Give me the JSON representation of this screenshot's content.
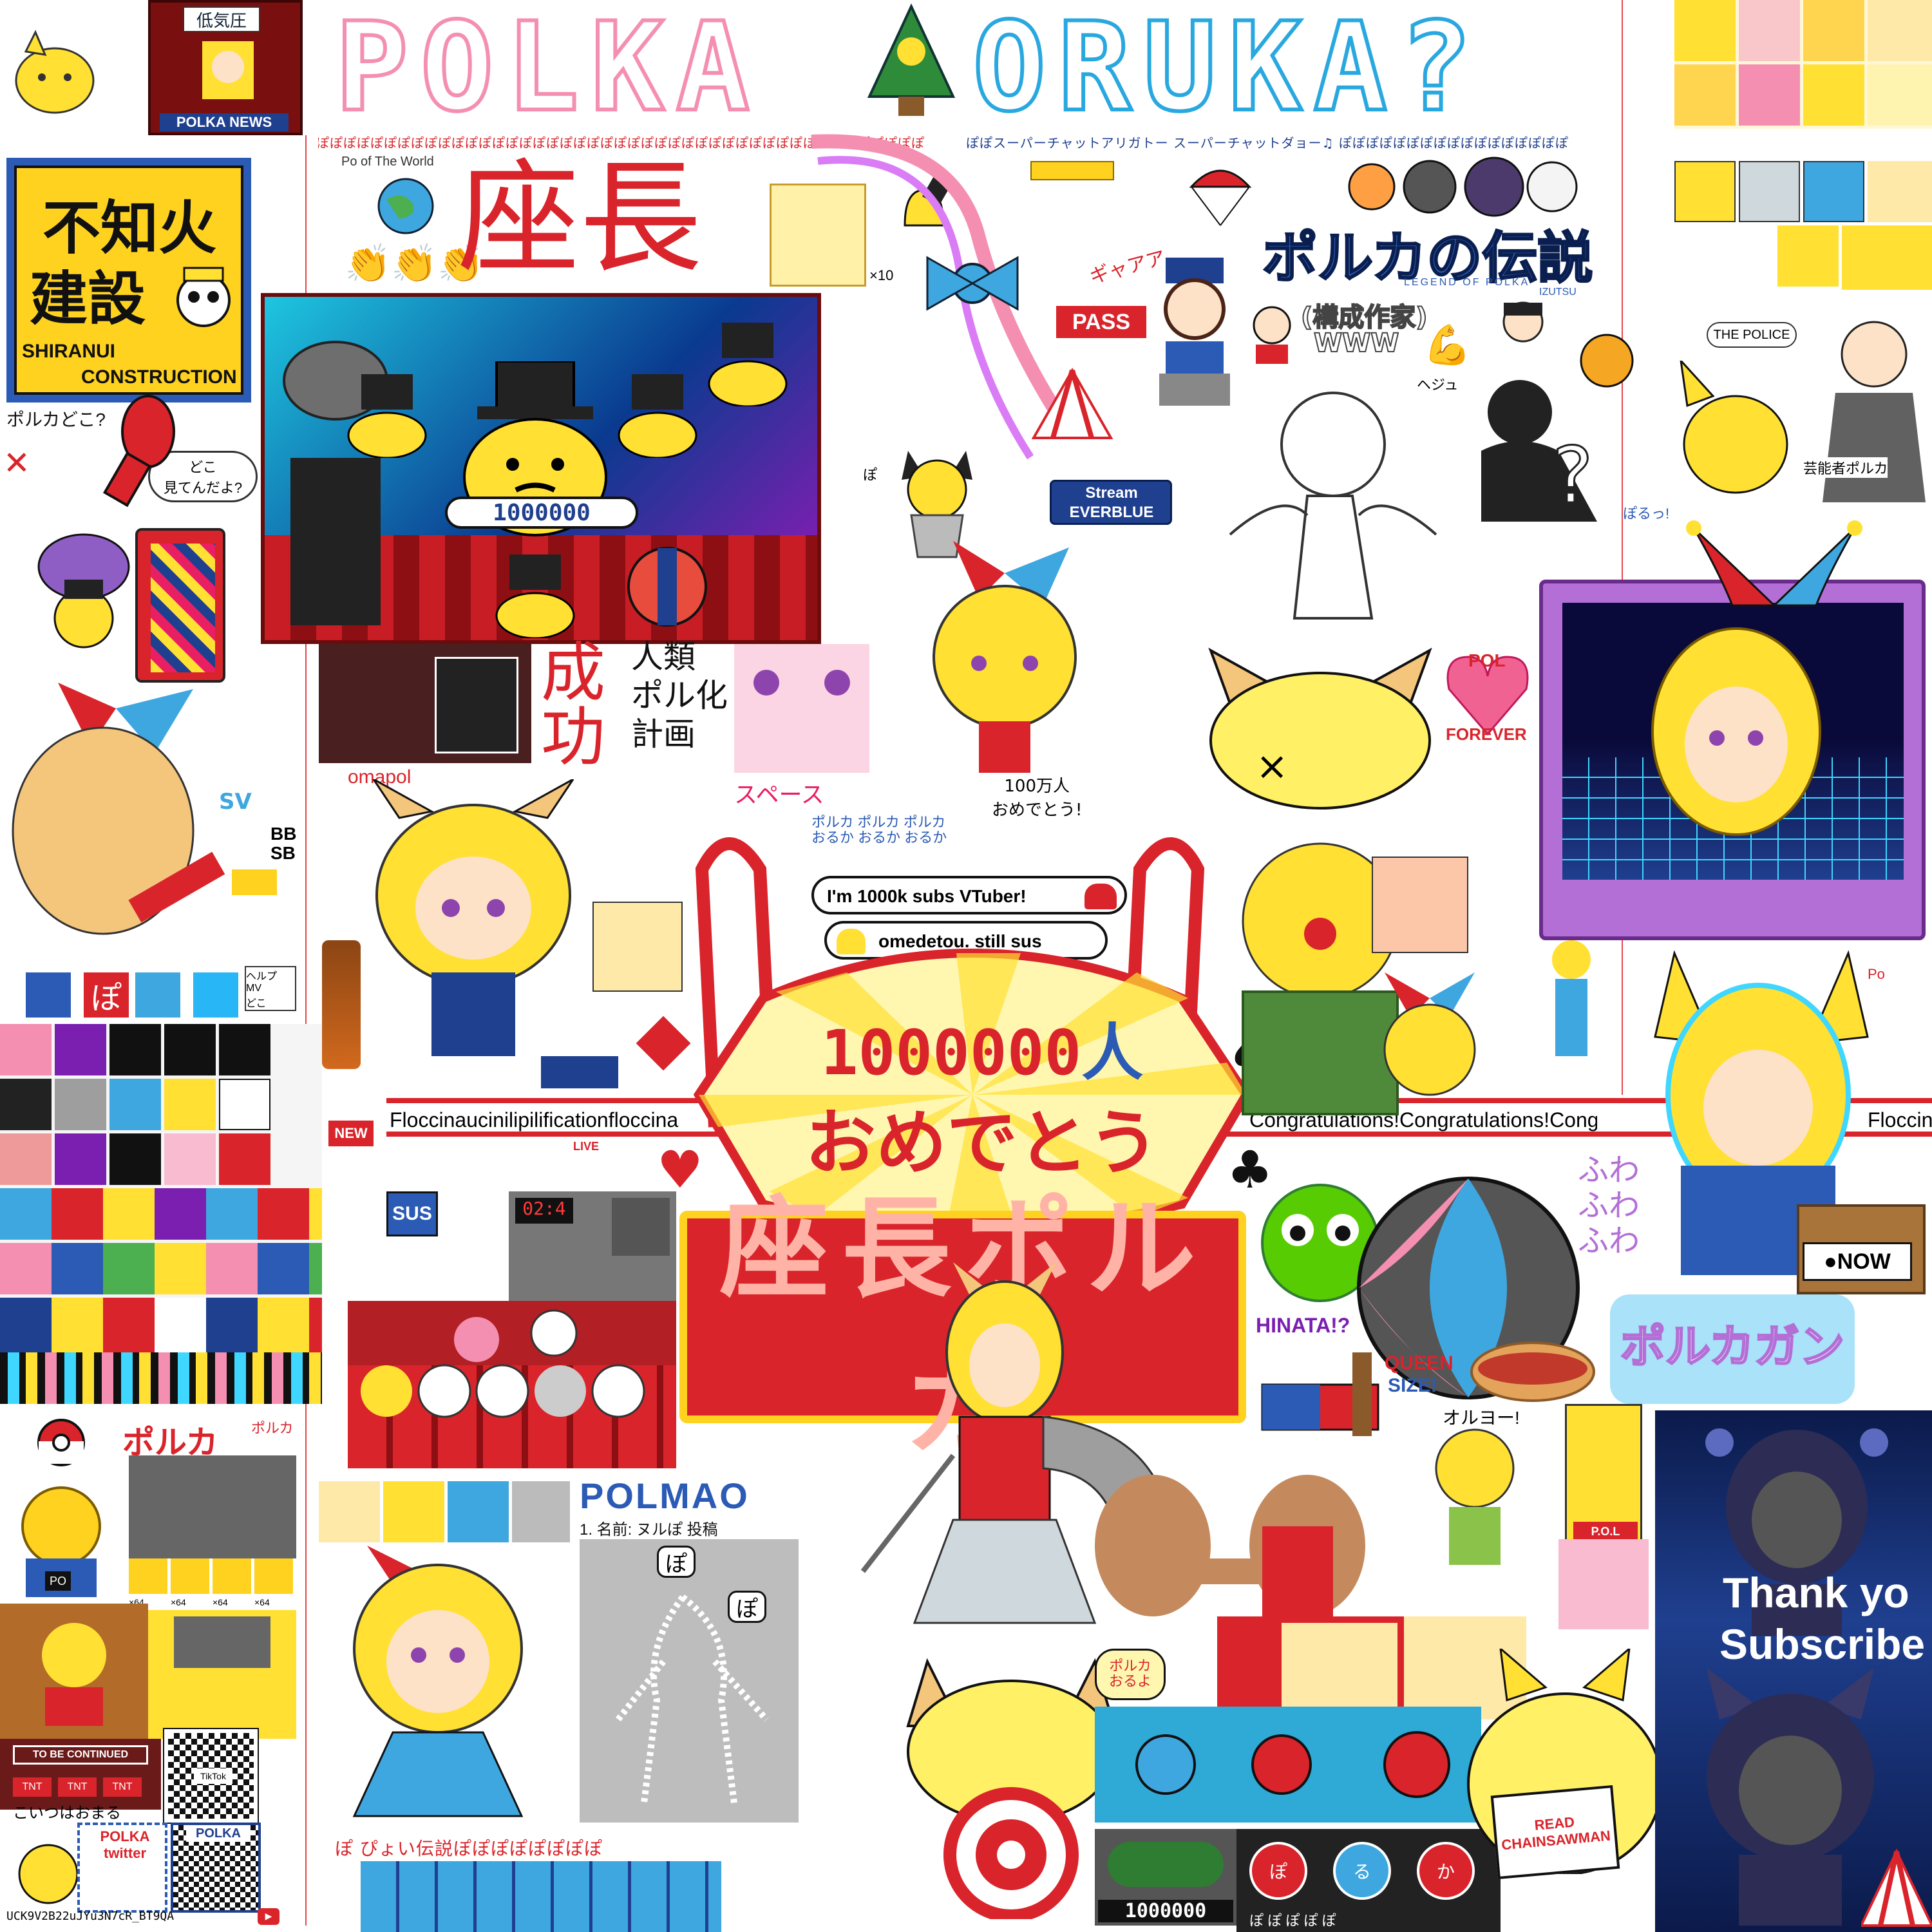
{
  "header": {
    "title_left": "POLKA",
    "title_right": "ORUKA?",
    "po_row": "ぽぽぽぽぽぽぽぽぽぽぽぽぽぽぽぽぽぽぽぽぽぽぽぽぽぽぽぽぽぽぽぽぽぽぽぽぽぽぽぽぽぽぽぽぽぽ",
    "superchat_text": "ぽぽスーパーチャットアリガトー スーパーチャットダョー♫ ぽぽぽぽぽぽぽぽぽぽぽぽぽぽぽぽぽ"
  },
  "top_left": {
    "news_sign": "低気圧",
    "news_banner": "POLKA NEWS",
    "construction_kanji_1": "不知火",
    "construction_kanji_2": "建設",
    "construction_en_1": "SHIRANUI",
    "construction_en_2": "CONSTRUCTION",
    "where_polka": "ポルカどこ?",
    "where_look": "どこ\n見てんだよ?"
  },
  "center_top": {
    "world_label": "Po of The World",
    "zacho": "座長",
    "x10": "×10",
    "gyaa": "ギャアア",
    "pass": "PASS",
    "stream_1": "Stream",
    "stream_2": "EVERBLUE",
    "po_small": "ぽ"
  },
  "right_top": {
    "legend_title": "ポルカの伝説",
    "legend_sub": "LEGEND OF POLKA",
    "izutsu": "IZUTSU",
    "kousei": "(構成作家)",
    "www": "WWW",
    "hegyu": "ヘジュ",
    "the_police": "THE POLICE",
    "geinou": "芸能者ポルカ",
    "porutsu": "ぽるっ!"
  },
  "middle": {
    "seikou": "成功",
    "jinrui_1": "人類",
    "jinrui_2": "ポル化",
    "jinrui_3": "計画",
    "omapol": "omapol",
    "space": "スペース",
    "million": "100万人\nおめでとう!",
    "polka_oruka": "ポルカ ポルカ ポルカ\nおるか おるか おるか",
    "sus_1": "I'm 1000k subs VTuber!",
    "sus_2": "omedetou. still sus",
    "pol_forever_1": "POL",
    "pol_forever_2": "FOREVER",
    "bbsb": "BB\nSB",
    "sv": "SV",
    "heru": "ヘルプ\nMV\nどこ",
    "new": "NEW",
    "live": "LIVE",
    "sus": "SUS",
    "time": "02:4"
  },
  "center_sign": {
    "subs_count": "1000000",
    "subs_unit": "人",
    "congrats": "おめでとう",
    "marquee_text": "座長ポルカ",
    "banner_left": "Floccinaucinilipilificationfloccina",
    "banner_right": "Congratulations!Congratulations!Congratulations!Congra",
    "banner_far": "Floccina"
  },
  "right_mid": {
    "fuwa": "ふわ\nふわ\nふわ",
    "now": "●NOW",
    "polkagun": "ポルカガン",
    "hinata": "HINATA!?",
    "queen_1": "QUEEN",
    "queen_2": "SIZE!",
    "oruyo_call": "オルヨー!",
    "po_side": "Po"
  },
  "bottom_left": {
    "polka_pink": "ポルカ",
    "poruka": "ポルカ",
    "x64": "×64",
    "to_be_continued": "TO BE CONTINUED",
    "tnt": "TNT",
    "koitsu": "こいつはおまる",
    "polka_twitter": "POLKA\ntwitter",
    "polka_qr": "POLKA",
    "tiktok": "TikTok",
    "channel_id": "UCK9V2B22uJYu3N7cR_BT9QA",
    "po_label": "PO"
  },
  "bottom_center": {
    "polmao": "POLMAO",
    "name_row": "1. 名前: ヌルぽ 投稿",
    "po_speech_1": "ぽ",
    "po_speech_2": "ぽ",
    "denisetsu": "ぽ ぴょい伝説ぽぽぽぽぽぽぽぽ",
    "polka_oruyo": "ポルカ\nおるよ",
    "counter": "1000000",
    "read": "READ\nCHAINSAWMAN",
    "taiko": [
      "ぽ",
      "る",
      "か"
    ],
    "taiko_po": "ぽ ぽ ぽ ぽ ぽ"
  },
  "bottom_right": {
    "thank_1": "Thank yo",
    "thank_2": "Subscribe",
    "pol_badge": "P.O.L"
  },
  "colors": {
    "pink": "#f48fb1",
    "blue": "#29a8e0",
    "red": "#d9242b",
    "yellow": "#ffe033",
    "navy": "#1f3f8f"
  }
}
